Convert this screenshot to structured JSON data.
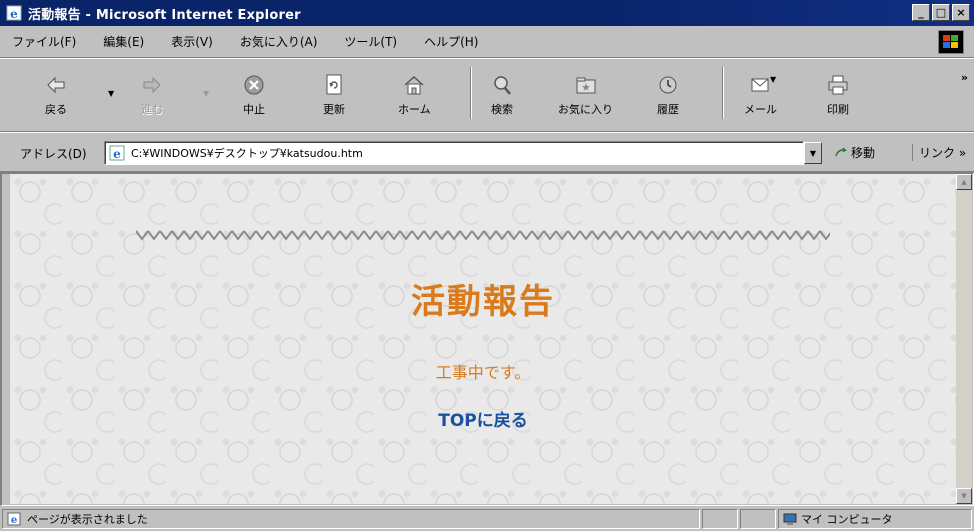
{
  "window": {
    "title": "活動報告 - Microsoft Internet Explorer",
    "buttons": [
      "_",
      "□",
      "×"
    ]
  },
  "menubar": {
    "items": [
      "ファイル(F)",
      "編集(E)",
      "表示(V)",
      "お気に入り(A)",
      "ツール(T)",
      "ヘルプ(H)"
    ]
  },
  "toolbar": {
    "back": "戻る",
    "forward": "進む",
    "stop": "中止",
    "refresh": "更新",
    "home": "ホーム",
    "search": "検索",
    "favorites": "お気に入り",
    "history": "履歴",
    "mail": "メール",
    "print": "印刷",
    "more": "»"
  },
  "addressbar": {
    "label": "アドレス(D)",
    "url": "C:¥WINDOWS¥デスクトップ¥katsudou.htm",
    "go": "移動",
    "links": "リンク »"
  },
  "page": {
    "heading": "活動報告",
    "notice": "工事中です。",
    "top_link": "TOPに戻る"
  },
  "statusbar": {
    "message": "ページが表示されました",
    "zone": "マイ コンピュータ"
  },
  "colors": {
    "heading": "#d97b1c",
    "link": "#1b4fa0",
    "titlebar": "#0a246a"
  }
}
